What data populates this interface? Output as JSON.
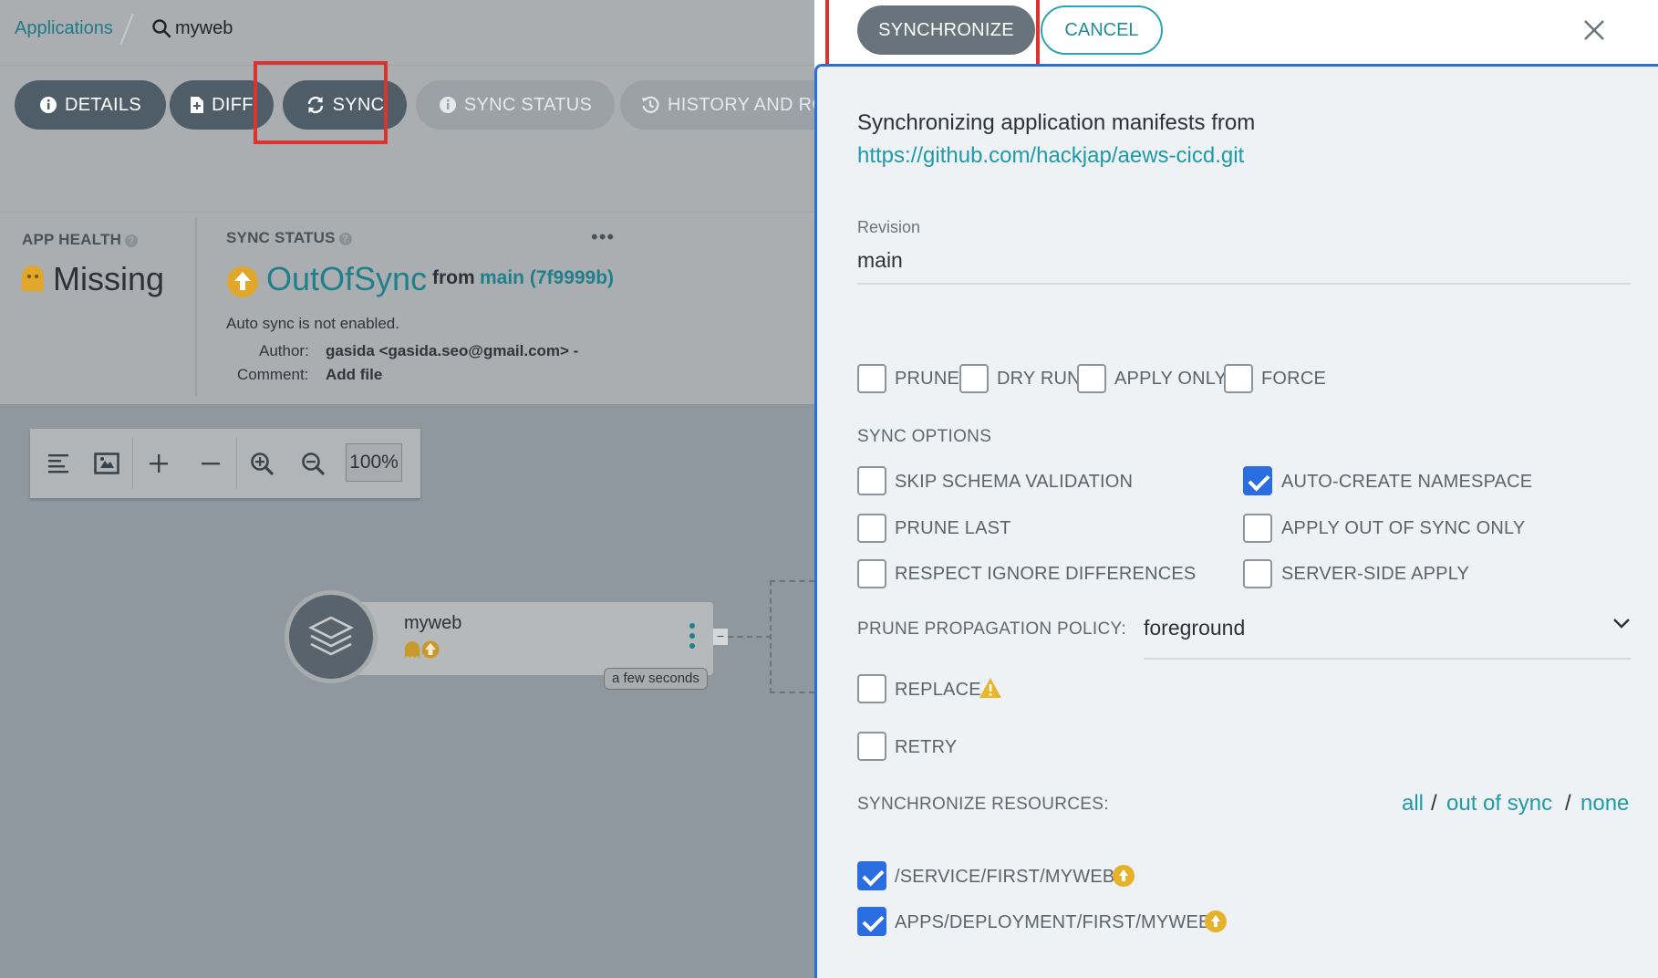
{
  "breadcrumb": {
    "root": "Applications",
    "app": "myweb"
  },
  "toolbar": {
    "details": "DETAILS",
    "diff": "DIFF",
    "sync": "SYNC",
    "sync_status": "SYNC STATUS",
    "history": "HISTORY AND ROLLBA"
  },
  "status": {
    "app_health_title": "APP HEALTH",
    "app_health_value": "Missing",
    "sync_status_title": "SYNC STATUS",
    "sync_status_value": "OutOfSync",
    "from_label": "from",
    "revision": "main (7f9999b)",
    "auto_sync": "Auto sync is not enabled.",
    "author_label": "Author:",
    "author_value": "gasida <gasida.seo@gmail.com> -",
    "comment_label": "Comment:",
    "comment_value": "Add file",
    "more": "•••"
  },
  "graph": {
    "zoom": "100%",
    "node_name": "myweb",
    "node_time": "a few seconds",
    "node_collapse": "−"
  },
  "panel": {
    "synchronize_button": "SYNCHRONIZE",
    "cancel_button": "CANCEL",
    "intro": "Synchronizing application manifests from",
    "repo_url": "https://github.com/hackjap/aews-cicd.git",
    "revision_label": "Revision",
    "revision_value": "main",
    "options": [
      {
        "label": "PRUNE",
        "checked": false
      },
      {
        "label": "DRY RUN",
        "checked": false
      },
      {
        "label": "APPLY ONLY",
        "checked": false
      },
      {
        "label": "FORCE",
        "checked": false
      }
    ],
    "sync_options_title": "SYNC OPTIONS",
    "sync_options": [
      {
        "label": "SKIP SCHEMA VALIDATION",
        "checked": false
      },
      {
        "label": "AUTO-CREATE NAMESPACE",
        "checked": true
      },
      {
        "label": "PRUNE LAST",
        "checked": false
      },
      {
        "label": "APPLY OUT OF SYNC ONLY",
        "checked": false
      },
      {
        "label": "RESPECT IGNORE DIFFERENCES",
        "checked": false
      },
      {
        "label": "SERVER-SIDE APPLY",
        "checked": false
      }
    ],
    "prune_policy_label": "PRUNE PROPAGATION POLICY:",
    "prune_policy_value": "foreground",
    "replace_label": "REPLACE",
    "retry_label": "RETRY",
    "resources_label": "SYNCHRONIZE RESOURCES:",
    "resources_filter": {
      "all": "all",
      "out_of_sync": "out of sync",
      "none": "none",
      "sep": "/"
    },
    "resources": [
      {
        "label": "/SERVICE/FIRST/MYWEB",
        "checked": true,
        "status_icon": "out-of-sync-icon"
      },
      {
        "label": "APPS/DEPLOYMENT/FIRST/MYWEB",
        "checked": true,
        "status_icon": "out-of-sync-icon"
      }
    ]
  },
  "colors": {
    "accent": "#1f9aa8",
    "checkbox_checked": "#2a6de0",
    "highlight_box": "#d9342f",
    "out_of_sync": "#e5b22b"
  }
}
